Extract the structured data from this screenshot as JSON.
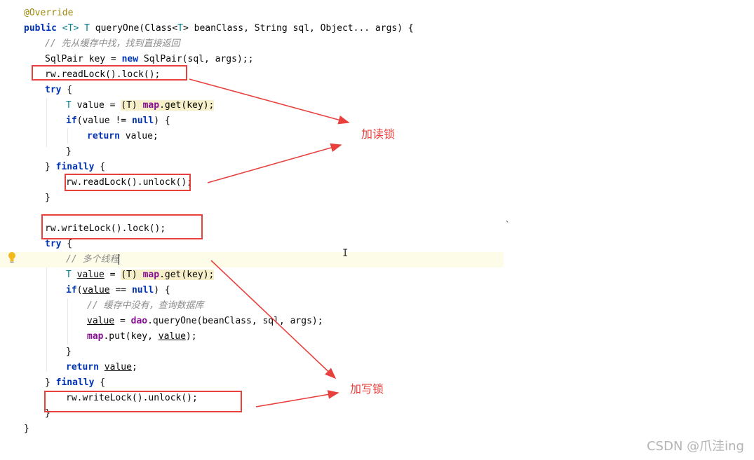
{
  "code": {
    "annotation": "@Override",
    "method_sig": {
      "kw": "public",
      "generic": "<T> T",
      "rest": " queryOne(Class<",
      "t2": "T",
      "rest2": "> beanClass, String sql, Object... args) {"
    },
    "comment1": "// 先从缓存中找，找到直接返回",
    "key_line": "SqlPair key = ",
    "key_new": "new",
    "key_rest": " SqlPair(sql, args);;",
    "readlock": "rw.readLock().lock();",
    "try1": "try",
    "brace_open": " {",
    "t_value_type": "T",
    "t_value_mid": " value = ",
    "cast": "(T)",
    "map": "map",
    "get_key": ".get(key);",
    "if_kw": "if",
    "if_rest": "(value != ",
    "null_kw": "null",
    "if_end": ") {",
    "return_kw": "return",
    "return_rest": " value;",
    "close": "}",
    "finally_open": "} ",
    "finally_kw": "finally",
    "read_unlock": "rw.readLock().unlock();",
    "writelock": "rw.writeLock().lock();",
    "comment2": "// 多个线程",
    "value_word": "value",
    "if2_mid": " == ",
    "comment3": "// 缓存中没有，查询数据库",
    "assign_mid": " = ",
    "dao": "dao",
    "dao_rest": ".queryOne(beanClass, sql, args);",
    "map_put": ".put(key, ",
    "map_put_end": ");",
    "semi": ";",
    "write_unlock": "rw.writeLock().unlock();"
  },
  "annotations": {
    "read_lock_label": "加读锁",
    "write_lock_label": "加写锁"
  },
  "watermark": "CSDN @爪洼ing",
  "colors": {
    "accent": "#e8413d",
    "keyword": "#0033b3",
    "field": "#871094",
    "comment": "#8c8c8c"
  },
  "icons": [
    "bulb-icon",
    "text-cursor-icon"
  ]
}
